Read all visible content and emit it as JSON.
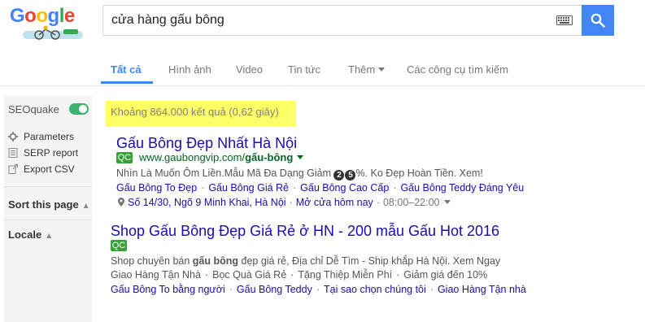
{
  "header": {
    "logo_letters": [
      "G",
      "o",
      "o",
      "g",
      "l",
      "e"
    ],
    "search_value": "cửa hàng gấu bông",
    "keyboard_icon": "keyboard-icon",
    "search_icon": "search-icon"
  },
  "tabs": {
    "items": [
      "Tất cả",
      "Hình ảnh",
      "Video",
      "Tin tức",
      "Thêm",
      "Các công cụ tìm kiếm"
    ]
  },
  "sidebar": {
    "title": "SEOquake",
    "items": [
      "Parameters",
      "SERP report",
      "Export CSV"
    ],
    "sort_label": "Sort this page",
    "locale_label": "Locale"
  },
  "results": {
    "stats": "Khoảng 864.000 kết quả (0,62 giây)",
    "ad1": {
      "title": "Gấu Bông Đẹp Nhất Hà Nội",
      "badge": "QC",
      "url_prefix": "www.gaubongvip.com/",
      "url_bold": "gấu-bông",
      "desc_before": "Nhìn Là Muốn Ôm Liền.Mẫu Mã Đa Dạng Giảm ",
      "desc_num1": "2",
      "desc_num2": "5",
      "desc_after": "%. Ko Đẹp Hoàn Tiền. Xem!",
      "sitelinks": [
        "Gấu Bông To Đẹp",
        "Gấu Bông Giá Rẻ",
        "Gấu Bông Cao Cấp",
        "Gấu Bông Teddy Đáng Yêu"
      ],
      "location": "Số 14/30, Ngõ 9 Minh Khai, Hà Nội",
      "hours_label": "Mở cửa hôm nay",
      "hours": "08:00–22:00"
    },
    "ad2": {
      "title": "Shop Gấu Bông Đẹp Giá Rẻ ở HN - 200 mẫu Gấu Hot 2016",
      "badge": "QC",
      "desc1_before": "Shop chuyên bán ",
      "desc1_bold": "gấu bông",
      "desc1_after": " đẹp giá rẻ, Địa chỉ Dễ Tìm - Ship khắp Hà Nội. Xem Ngay",
      "desc2": [
        "Giao Hàng Tận Nhà",
        "Bọc Quà Giá Rẻ",
        "Tặng Thiệp Miễn Phí",
        "Giảm giá đến 10%"
      ],
      "sitelinks": [
        "Gấu Bông To bằng người",
        "Gấu Bông Teddy",
        "Tại sao chọn chúng tôi",
        "Giao Hàng Tận nhà"
      ]
    }
  },
  "colors": {
    "link": "#1a0dab",
    "url_green": "#006621",
    "accent_blue": "#4285f4",
    "highlight": "#ffff66",
    "ad_badge": "#38a238",
    "toggle_on": "#3cb371"
  }
}
